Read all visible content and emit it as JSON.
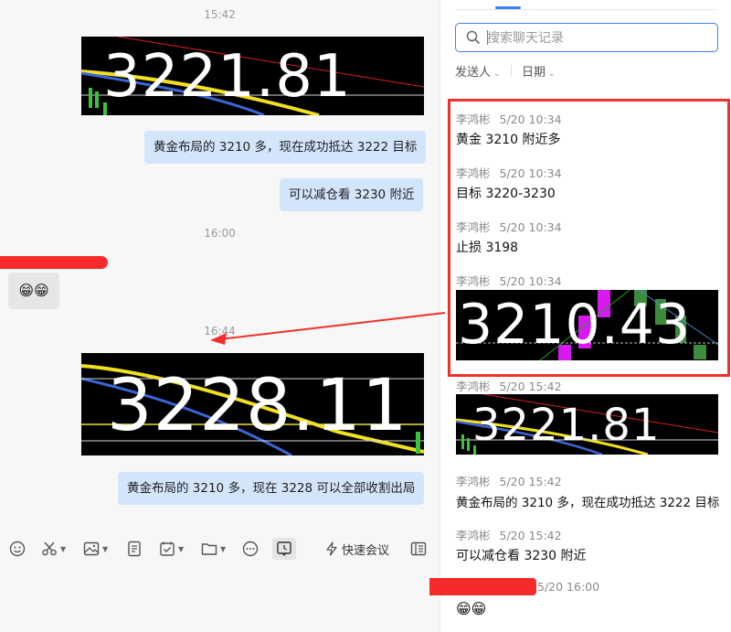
{
  "chat": {
    "time1": "15:42",
    "stock1": "3221.81",
    "msg1": "黄金布局的 3210 多，现在成功抵达 3222 目标",
    "msg2": "可以减仓看 3230 附近",
    "time2": "16:00",
    "emoji": "😁😁",
    "time3": "16:44",
    "stock2": "3228.11",
    "msg3": "黄金布局的 3210 多，现在 3228 可以全部收割出局"
  },
  "toolbar": {
    "emoji_icon": "smile-icon",
    "scissors_icon": "scissors-icon",
    "image_icon": "image-icon",
    "doc_icon": "document-icon",
    "task_icon": "task-icon",
    "folder_icon": "folder-icon",
    "more_icon": "more-icon",
    "history_icon": "history-icon",
    "quick_meeting": "快速会议",
    "panel_icon": "panel-icon"
  },
  "history": {
    "search_placeholder": "搜索聊天记录",
    "filter_sender": "发送人",
    "filter_date": "日期",
    "entries": [
      {
        "sender": "李鸿彬",
        "date": "5/20 10:34",
        "text": "黄金 3210 附近多"
      },
      {
        "sender": "李鸿彬",
        "date": "5/20 10:34",
        "text": "目标 3220-3230"
      },
      {
        "sender": "李鸿彬",
        "date": "5/20 10:34",
        "text": "止损 3198"
      },
      {
        "sender": "李鸿彬",
        "date": "5/20 10:34",
        "stock": "3210.43"
      },
      {
        "sender": "李鸿彬",
        "date": "5/20 15:42",
        "stock": "3221.81"
      },
      {
        "sender": "李鸿彬",
        "date": "5/20 15:42",
        "text": "黄金布局的 3210 多，现在成功抵达 3222 目标"
      },
      {
        "sender": "李鸿彬",
        "date": "5/20 15:42",
        "text": "可以减仓看 3230 附近"
      },
      {
        "date": "5/20 16:00",
        "emoji": "😁😁"
      }
    ]
  },
  "colors": {
    "accent": "#3b7ff5",
    "bubble": "#d3e5fb",
    "highlight_red": "#f0302d"
  }
}
